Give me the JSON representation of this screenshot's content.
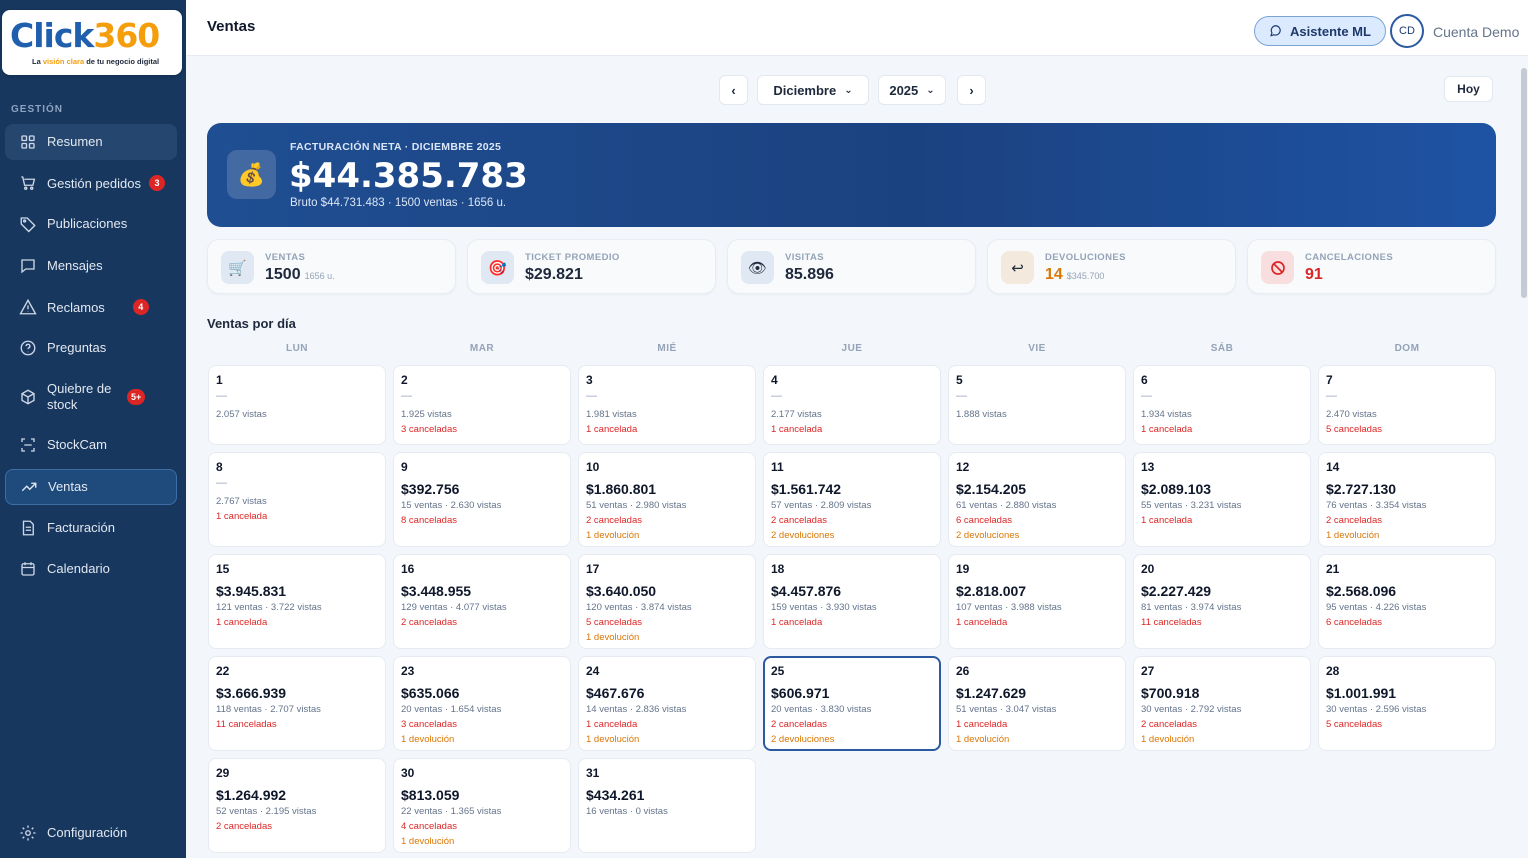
{
  "logo": {
    "name_main": "Click",
    "name_num": "360",
    "tagline_pre": "La ",
    "tagline_hl": "visión clara",
    "tagline_post": " de tu negocio digital"
  },
  "sidebar": {
    "section": "GESTIÓN",
    "items": [
      {
        "label": "Resumen"
      },
      {
        "label": "Gestión pedidos",
        "badge": "3"
      },
      {
        "label": "Publicaciones"
      },
      {
        "label": "Mensajes"
      },
      {
        "label": "Reclamos",
        "badge": "4"
      },
      {
        "label": "Preguntas"
      },
      {
        "label": "Quiebre de stock",
        "badge": "5+"
      },
      {
        "label": "StockCam"
      },
      {
        "label": "Ventas"
      },
      {
        "label": "Facturación"
      },
      {
        "label": "Calendario"
      }
    ],
    "footer": "Configuración"
  },
  "header": {
    "title": "Ventas",
    "assistant": "Asistente ML",
    "avatar": "CD",
    "account": "Cuenta Demo"
  },
  "selector": {
    "prev": "‹",
    "month": "Diciembre",
    "year": "2025",
    "next": "›",
    "today": "Hoy"
  },
  "hero": {
    "label": "FACTURACIÓN NETA · DICIEMBRE 2025",
    "value": "$44.385.783",
    "sub": "Bruto $44.731.483  ·  1500 ventas  ·  1656 u."
  },
  "stats": [
    {
      "label": "VENTAS",
      "value": "1500",
      "extra": "1656 u.",
      "icon": "cart-icon"
    },
    {
      "label": "TICKET PROMEDIO",
      "value": "$29.821",
      "extra": "",
      "icon": "target-icon"
    },
    {
      "label": "VISITAS",
      "value": "85.896",
      "extra": "",
      "icon": "eye-icon"
    },
    {
      "label": "DEVOLUCIONES",
      "value": "14",
      "extra": "$345.700",
      "icon": "return-icon",
      "color": "#d97706"
    },
    {
      "label": "CANCELACIONES",
      "value": "91",
      "extra": "",
      "icon": "cancel-icon",
      "color": "#dc2626"
    }
  ],
  "calendar": {
    "title": "Ventas por día",
    "weekdays": [
      "LUN",
      "MAR",
      "MIÉ",
      "JUE",
      "VIE",
      "SÁB",
      "DOM"
    ],
    "days": [
      {
        "d": "1",
        "amt": "",
        "line": "2.057 vistas",
        "canc": "",
        "dev": ""
      },
      {
        "d": "2",
        "amt": "",
        "line": "1.925 vistas",
        "canc": "3 canceladas",
        "dev": ""
      },
      {
        "d": "3",
        "amt": "",
        "line": "1.981 vistas",
        "canc": "1 cancelada",
        "dev": ""
      },
      {
        "d": "4",
        "amt": "",
        "line": "2.177 vistas",
        "canc": "1 cancelada",
        "dev": ""
      },
      {
        "d": "5",
        "amt": "",
        "line": "1.888 vistas",
        "canc": "",
        "dev": ""
      },
      {
        "d": "6",
        "amt": "",
        "line": "1.934 vistas",
        "canc": "1 cancelada",
        "dev": ""
      },
      {
        "d": "7",
        "amt": "",
        "line": "2.470 vistas",
        "canc": "5 canceladas",
        "dev": ""
      },
      {
        "d": "8",
        "amt": "",
        "line": "2.767 vistas",
        "canc": "1 cancelada",
        "dev": ""
      },
      {
        "d": "9",
        "amt": "$392.756",
        "line": "15 ventas · 2.630 vistas",
        "canc": "8 canceladas",
        "dev": ""
      },
      {
        "d": "10",
        "amt": "$1.860.801",
        "line": "51 ventas · 2.980 vistas",
        "canc": "2 canceladas",
        "dev": "1 devolución"
      },
      {
        "d": "11",
        "amt": "$1.561.742",
        "line": "57 ventas · 2.809 vistas",
        "canc": "2 canceladas",
        "dev": "2 devoluciones"
      },
      {
        "d": "12",
        "amt": "$2.154.205",
        "line": "61 ventas · 2.880 vistas",
        "canc": "6 canceladas",
        "dev": "2 devoluciones"
      },
      {
        "d": "13",
        "amt": "$2.089.103",
        "line": "55 ventas · 3.231 vistas",
        "canc": "1 cancelada",
        "dev": ""
      },
      {
        "d": "14",
        "amt": "$2.727.130",
        "line": "76 ventas · 3.354 vistas",
        "canc": "2 canceladas",
        "dev": "1 devolución"
      },
      {
        "d": "15",
        "amt": "$3.945.831",
        "line": "121 ventas · 3.722 vistas",
        "canc": "1 cancelada",
        "dev": ""
      },
      {
        "d": "16",
        "amt": "$3.448.955",
        "line": "129 ventas · 4.077 vistas",
        "canc": "2 canceladas",
        "dev": ""
      },
      {
        "d": "17",
        "amt": "$3.640.050",
        "line": "120 ventas · 3.874 vistas",
        "canc": "5 canceladas",
        "dev": "1 devolución"
      },
      {
        "d": "18",
        "amt": "$4.457.876",
        "line": "159 ventas · 3.930 vistas",
        "canc": "1 cancelada",
        "dev": ""
      },
      {
        "d": "19",
        "amt": "$2.818.007",
        "line": "107 ventas · 3.988 vistas",
        "canc": "1 cancelada",
        "dev": ""
      },
      {
        "d": "20",
        "amt": "$2.227.429",
        "line": "81 ventas · 3.974 vistas",
        "canc": "11 canceladas",
        "dev": ""
      },
      {
        "d": "21",
        "amt": "$2.568.096",
        "line": "95 ventas · 4.226 vistas",
        "canc": "6 canceladas",
        "dev": ""
      },
      {
        "d": "22",
        "amt": "$3.666.939",
        "line": "118 ventas · 2.707 vistas",
        "canc": "11 canceladas",
        "dev": ""
      },
      {
        "d": "23",
        "amt": "$635.066",
        "line": "20 ventas · 1.654 vistas",
        "canc": "3 canceladas",
        "dev": "1 devolución"
      },
      {
        "d": "24",
        "amt": "$467.676",
        "line": "14 ventas · 2.836 vistas",
        "canc": "1 cancelada",
        "dev": "1 devolución"
      },
      {
        "d": "25",
        "amt": "$606.971",
        "line": "20 ventas · 3.830 vistas",
        "canc": "2 canceladas",
        "dev": "2 devoluciones",
        "selected": true
      },
      {
        "d": "26",
        "amt": "$1.247.629",
        "line": "51 ventas · 3.047 vistas",
        "canc": "1 cancelada",
        "dev": "1 devolución"
      },
      {
        "d": "27",
        "amt": "$700.918",
        "line": "30 ventas · 2.792 vistas",
        "canc": "2 canceladas",
        "dev": "1 devolución"
      },
      {
        "d": "28",
        "amt": "$1.001.991",
        "line": "30 ventas · 2.596 vistas",
        "canc": "5 canceladas",
        "dev": ""
      },
      {
        "d": "29",
        "amt": "$1.264.992",
        "line": "52 ventas · 2.195 vistas",
        "canc": "2 canceladas",
        "dev": ""
      },
      {
        "d": "30",
        "amt": "$813.059",
        "line": "22 ventas · 1.365 vistas",
        "canc": "4 canceladas",
        "dev": "1 devolución"
      },
      {
        "d": "31",
        "amt": "$434.261",
        "line": "16 ventas · 0 vistas",
        "canc": "",
        "dev": ""
      }
    ]
  }
}
